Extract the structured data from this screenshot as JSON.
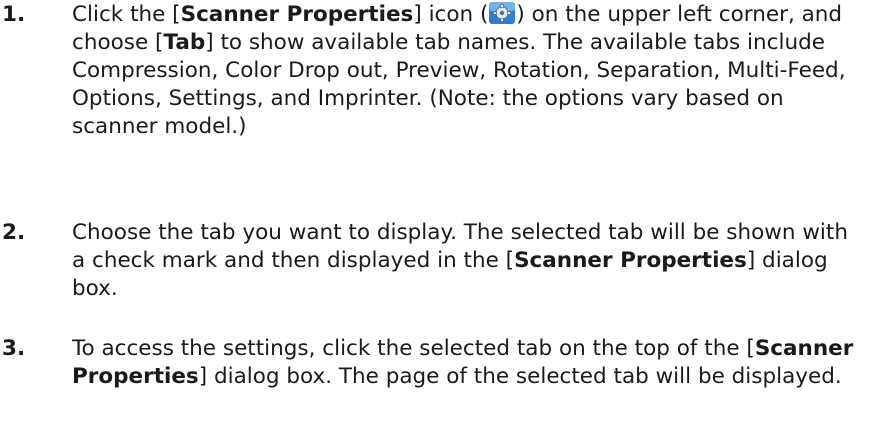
{
  "steps": [
    {
      "number": "1.",
      "t1": "Click the [",
      "b1": "Scanner Properties",
      "t2": "] icon (",
      "icon": "scanner-properties-gear-icon",
      "t3": ") on the upper left corner, and choose [",
      "b2": "Tab",
      "t4": "] to show available tab names. The available tabs include Compression, Color Drop out, Preview, Rotation, Separation, Multi-Feed, Options, Settings, and Imprinter. (Note: the options vary based on scanner model.)"
    },
    {
      "number": "2.",
      "t1": "Choose the tab you want to display. The selected tab will be shown with a check mark and then displayed in the [",
      "b1": "Scanner Properties",
      "t2": "] dialog box."
    },
    {
      "number": "3.",
      "t1": "To access the settings, click the selected tab on the top of the [",
      "b1": "Scanner Properties",
      "t2": "] dialog box. The page of the selected tab will be displayed."
    }
  ],
  "colors": {
    "text": "#1a1a1a",
    "icon_blue": "#2f7fd6"
  }
}
